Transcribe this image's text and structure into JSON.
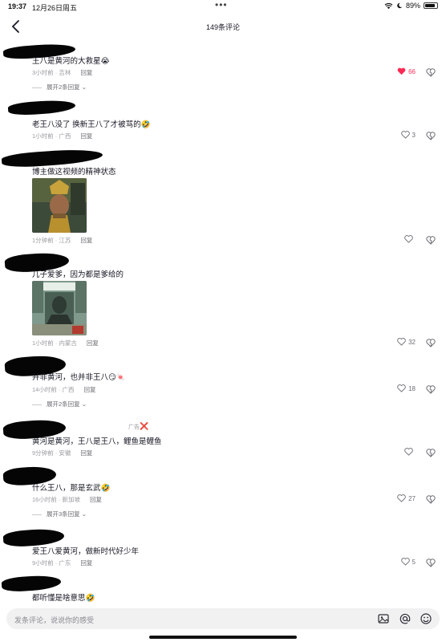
{
  "status_bar": {
    "time": "19:37",
    "date": "12月26日周五",
    "battery": "89%",
    "battery_level": 0.89
  },
  "header": {
    "title": "149条评论",
    "back_icon": "chevron-left-icon"
  },
  "colors": {
    "like_active": "#fe2c55",
    "text": "#161823",
    "meta": "#9a9ba1"
  },
  "comments": [
    {
      "text": "王八是黄河的大救星😭",
      "time": "3小时前",
      "location": "吉林",
      "reply": "回复",
      "likes": "66",
      "liked": true,
      "expand": "展开2条回复"
    },
    {
      "text": "老王八没了 换新王八了才被骂的🤣",
      "time": "1小时前",
      "location": "广西",
      "reply": "回复",
      "likes": "3"
    },
    {
      "text": "博主做这视频的精神状态",
      "time": "1分钟前",
      "location": "江苏",
      "reply": "回复",
      "likes": ""
    },
    {
      "text": "儿子爱爹，因为都是爹给的",
      "time": "1小时前",
      "location": "内蒙古",
      "reply": "回复",
      "likes": "32"
    },
    {
      "text": "并非黄河，也并非王八😏🍬",
      "time": "14小时前",
      "location": "广西",
      "reply": "回复",
      "likes": "18",
      "expand": "展开2条回复"
    },
    {
      "text": "黄河是黄河，王八是王八，鲤鱼是鲤鱼",
      "time": "9分钟前",
      "location": "安徽",
      "reply": "回复",
      "likes": "",
      "ad_label": "广告",
      "ad_mark": "❌"
    },
    {
      "text": "什么王八，那是玄武🤣",
      "time": "16小时前",
      "location": "新加坡",
      "reply": "回复",
      "likes": "27",
      "expand": "展开3条回复"
    },
    {
      "text": "爱王八爱黄河，做新时代好少年",
      "time": "9小时前",
      "location": "广东",
      "reply": "回复",
      "likes": "5"
    },
    {
      "text": "都听懂是啥意思🤣"
    }
  ],
  "image_attachments": [
    {
      "for_comment": 2,
      "description_icon": "photo-thumbnail"
    },
    {
      "for_comment": 3,
      "description_icon": "poster-thumbnail"
    }
  ],
  "input_bar": {
    "placeholder": "发条评论，说说你的感受",
    "icons": [
      "image-icon",
      "at-icon",
      "emoji-icon"
    ]
  }
}
